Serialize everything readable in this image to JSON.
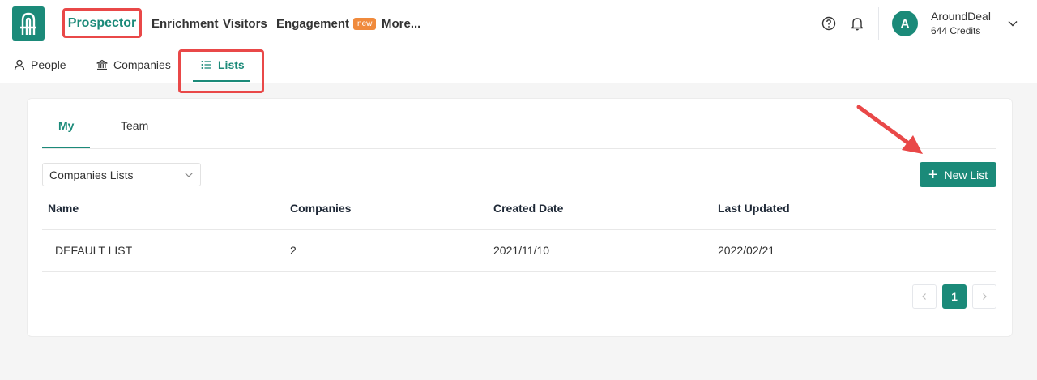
{
  "nav": {
    "items": [
      "Prospector",
      "Enrichment",
      "Visitors",
      "Engagement",
      "More..."
    ],
    "badge_new": "new",
    "help_icon": "help-circle-icon",
    "bell_icon": "bell-icon"
  },
  "user": {
    "avatar_letter": "A",
    "name": "AroundDeal",
    "credits": "644 Credits"
  },
  "subnav": {
    "items": [
      "People",
      "Companies",
      "Lists"
    ],
    "active": "Lists"
  },
  "card": {
    "tabs": [
      "My",
      "Team"
    ],
    "active_tab": "My",
    "select_value": "Companies Lists",
    "new_list_label": "New List"
  },
  "table": {
    "headers": [
      "Name",
      "Companies",
      "Created Date",
      "Last Updated"
    ],
    "rows": [
      [
        "DEFAULT LIST",
        "2",
        "2021/11/10",
        "2022/02/21"
      ]
    ]
  },
  "pagination": {
    "current": "1"
  },
  "colors": {
    "brand": "#1b8a79",
    "highlight": "#e94848",
    "badge": "#f08a3c"
  }
}
